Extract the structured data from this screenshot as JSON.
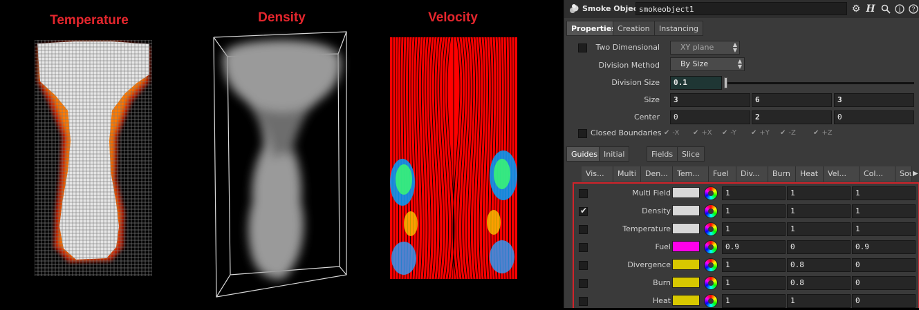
{
  "viz": {
    "temperature_label": "Temperature",
    "density_label": "Density",
    "velocity_label": "Velocity"
  },
  "header": {
    "node_type": "Smoke Object",
    "node_name": "smokeobject1",
    "icons": [
      "gear-icon",
      "help-h-icon",
      "search-icon",
      "info-icon",
      "about-icon"
    ]
  },
  "tabs": [
    {
      "label": "Properties",
      "active": true
    },
    {
      "label": "Creation",
      "active": false
    },
    {
      "label": "Instancing",
      "active": false
    }
  ],
  "properties": {
    "two_dimensional": {
      "label": "Two Dimensional",
      "checked": false,
      "value": "XY plane"
    },
    "division_method": {
      "label": "Division Method",
      "value": "By Size"
    },
    "division_size": {
      "label": "Division Size",
      "value": "0.1"
    },
    "size": {
      "label": "Size",
      "values": [
        "3",
        "6",
        "3"
      ]
    },
    "center": {
      "label": "Center",
      "values": [
        "0",
        "2",
        "0"
      ]
    },
    "closed_boundaries": {
      "label": "Closed Boundaries",
      "checked": false,
      "axes": [
        "-X",
        "+X",
        "-Y",
        "+Y",
        "-Z",
        "+Z"
      ]
    }
  },
  "subtabs": [
    {
      "label": "Guides",
      "active": true
    },
    {
      "label": "Initial Data",
      "active": false
    },
    {
      "label": "Fields",
      "active": false
    },
    {
      "label": "Slice",
      "active": false
    }
  ],
  "columns": [
    "Vis...",
    "Multi",
    "Den...",
    "Tem...",
    "Fuel",
    "Div...",
    "Burn",
    "Heat",
    "Vel...",
    "Col...",
    "Sou..."
  ],
  "guides": [
    {
      "label": "Multi Field",
      "checked": false,
      "color": "#d8d8d8",
      "values": [
        "1",
        "1",
        "1"
      ]
    },
    {
      "label": "Density",
      "checked": true,
      "color": "#d8d8d8",
      "values": [
        "1",
        "1",
        "1"
      ]
    },
    {
      "label": "Temperature",
      "checked": false,
      "color": "#d8d8d8",
      "values": [
        "1",
        "1",
        "1"
      ]
    },
    {
      "label": "Fuel",
      "checked": false,
      "color": "#ff00ea",
      "values": [
        "0.9",
        "0",
        "0.9"
      ]
    },
    {
      "label": "Divergence",
      "checked": false,
      "color": "#d8c800",
      "values": [
        "1",
        "0.8",
        "0"
      ]
    },
    {
      "label": "Burn",
      "checked": false,
      "color": "#d8c800",
      "values": [
        "1",
        "0.8",
        "0"
      ]
    },
    {
      "label": "Heat",
      "checked": false,
      "color": "#d8c800",
      "values": [
        "1",
        "1",
        "0"
      ]
    }
  ]
}
